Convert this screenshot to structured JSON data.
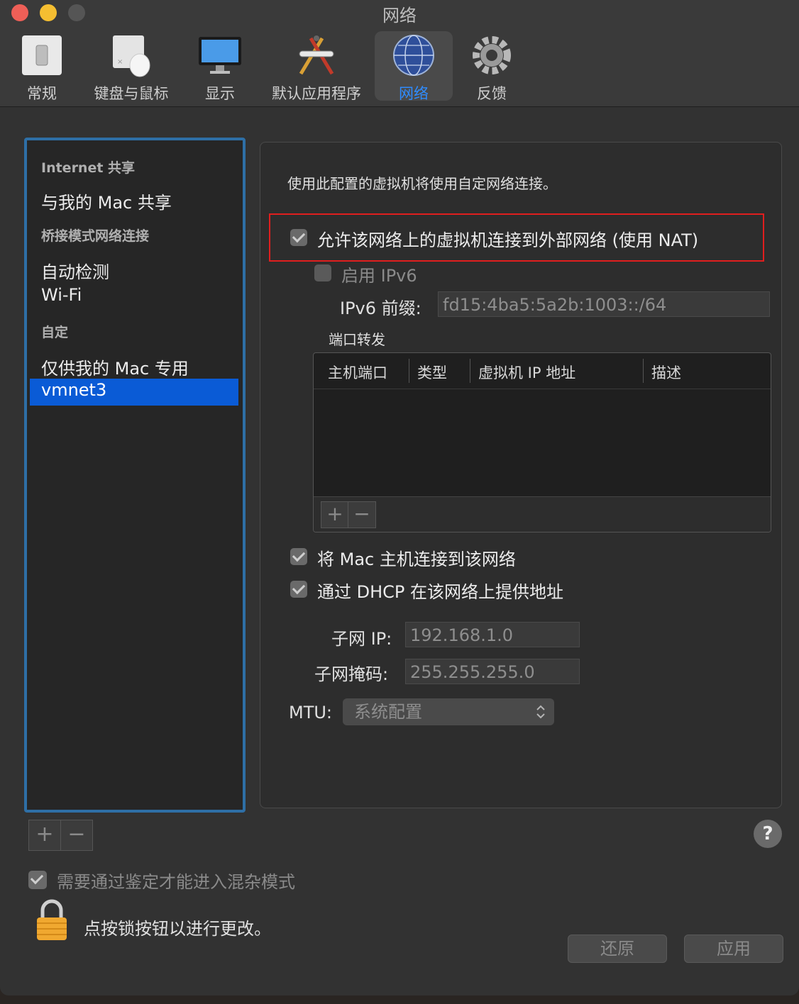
{
  "window": {
    "title": "网络"
  },
  "toolbar": {
    "items": [
      {
        "label": "常规",
        "icon": "switch-icon"
      },
      {
        "label": "键盘与鼠标",
        "icon": "keyboard-mouse-icon"
      },
      {
        "label": "显示",
        "icon": "display-icon"
      },
      {
        "label": "默认应用程序",
        "icon": "apps-icon"
      },
      {
        "label": "网络",
        "icon": "globe-icon",
        "active": true
      },
      {
        "label": "反馈",
        "icon": "gear-icon"
      }
    ]
  },
  "sidebar": {
    "sections": [
      {
        "header": "Internet 共享",
        "items": [
          "与我的 Mac 共享"
        ]
      },
      {
        "header": "桥接模式网络连接",
        "items": [
          "自动检测",
          "Wi-Fi"
        ]
      },
      {
        "header": "自定",
        "items": [
          "仅供我的 Mac 专用",
          "vmnet3"
        ]
      }
    ],
    "selected": "vmnet3",
    "add": "+",
    "remove": "−"
  },
  "panel": {
    "description": "使用此配置的虚拟机将使用自定网络连接。",
    "nat_label": "允许该网络上的虚拟机连接到外部网络 (使用 NAT)",
    "nat_checked": true,
    "ipv6_label": "启用 IPv6",
    "ipv6_checked": false,
    "ipv6_prefix_label": "IPv6 前缀:",
    "ipv6_prefix_value": "fd15:4ba5:5a2b:1003::/64",
    "port_forward_label": "端口转发",
    "table_headers": [
      "主机端口",
      "类型",
      "虚拟机 IP 地址",
      "描述"
    ],
    "table_add": "+",
    "table_remove": "−",
    "connect_mac_label": "将 Mac 主机连接到该网络",
    "connect_mac_checked": true,
    "dhcp_label": "通过 DHCP 在该网络上提供地址",
    "dhcp_checked": true,
    "subnet_ip_label": "子网 IP:",
    "subnet_ip_value": "192.168.1.0",
    "subnet_mask_label": "子网掩码:",
    "subnet_mask_value": "255.255.255.0",
    "mtu_label": "MTU:",
    "mtu_value": "系统配置"
  },
  "footer": {
    "promisc_label": "需要通过鉴定才能进入混杂模式",
    "promisc_checked": true,
    "lock_label": "点按锁按钮以进行更改。",
    "revert": "还原",
    "apply": "应用",
    "help": "?"
  },
  "colors": {
    "accent": "#2f8cff",
    "selection": "#0a5bd6",
    "highlight_box": "#e01e1e"
  }
}
